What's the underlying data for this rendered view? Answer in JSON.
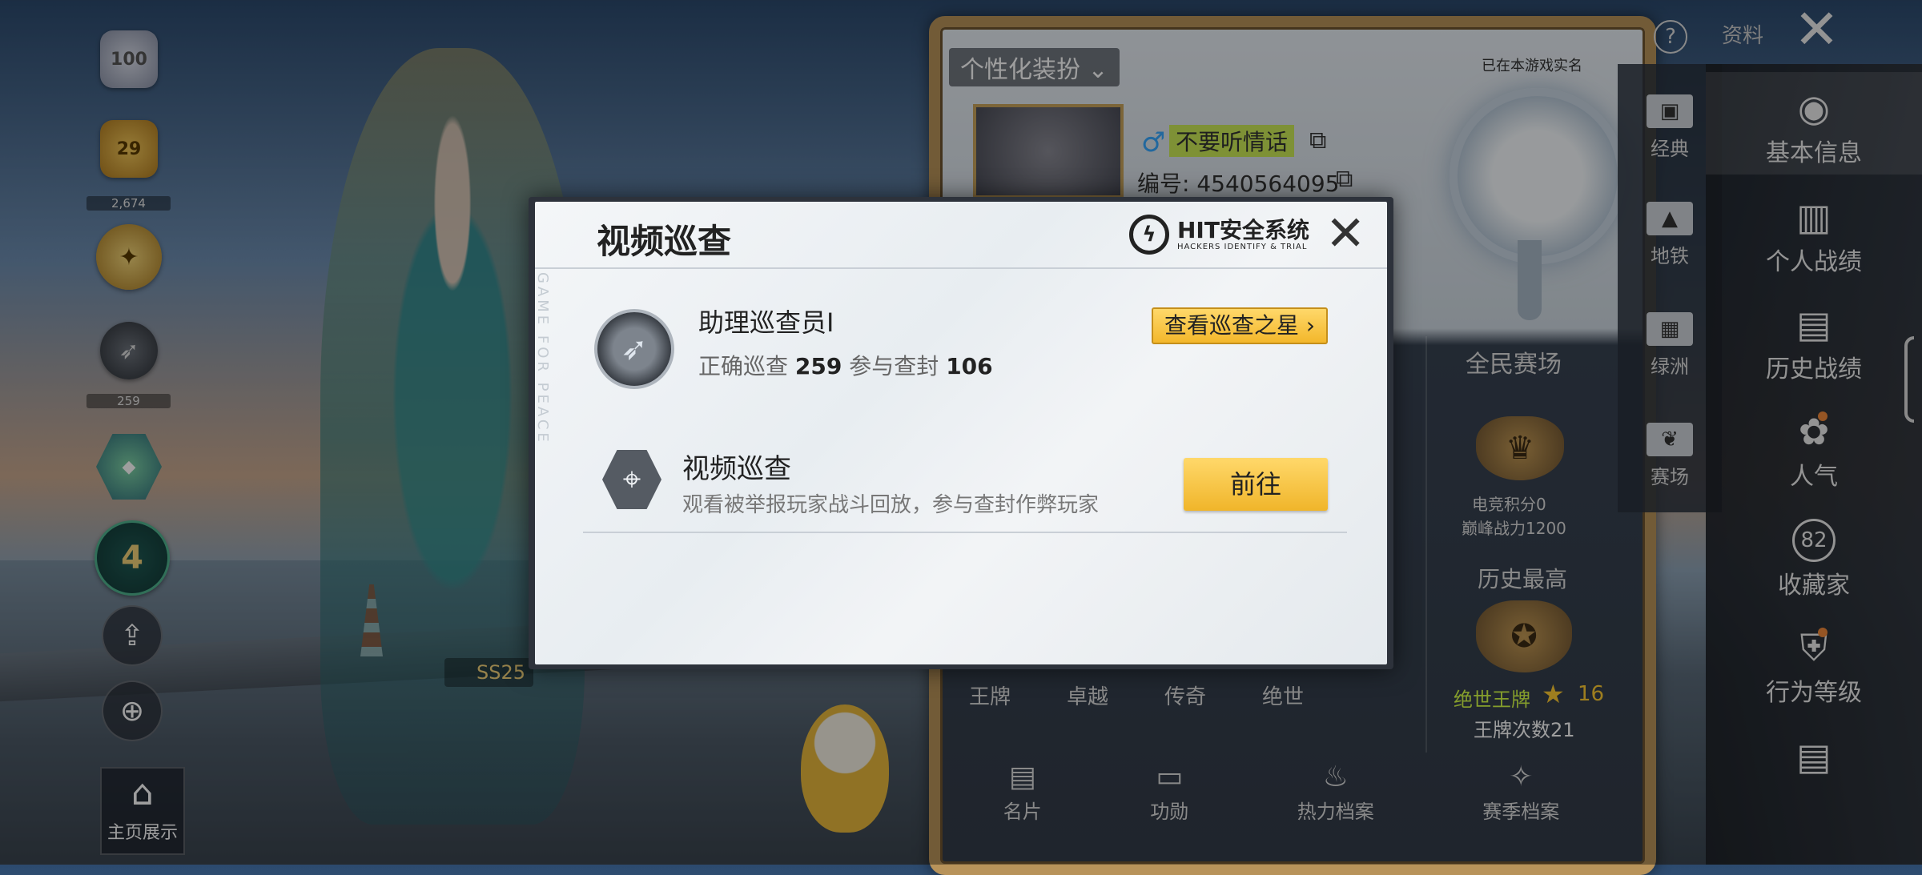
{
  "sidebar": {
    "badge1_value": "100",
    "badge2_value": "29",
    "badge2_count": "2,674",
    "badge4_count": "259",
    "badge6_value": "4",
    "home_show_label": "主页展示"
  },
  "profile": {
    "custom_label": "个性化装扮",
    "synced_text": "已在本游戏实名",
    "player_name": "不要听情话",
    "player_id": "编号: 4540564095",
    "gender_symbol": "♂",
    "help_icon": "?",
    "info_label": "资料",
    "mode_label": "全民赛场",
    "points_label": "电竞积分0",
    "peak_label": "巅峰战力1200",
    "history_label": "历史最高",
    "ace_tier": "绝世王牌",
    "ace_level": "16",
    "ace_count": "王牌次数21",
    "tiers": [
      "王牌",
      "卓越",
      "传奇",
      "绝世"
    ],
    "bottom_tabs": [
      "名片",
      "功勋",
      "热力档案",
      "赛季档案"
    ],
    "season_label": "SS25"
  },
  "categories": [
    "经典",
    "地铁",
    "绿洲",
    "赛场"
  ],
  "right_menu": [
    "基本信息",
    "个人战绩",
    "历史战绩",
    "人气",
    "收藏家",
    "行为等级"
  ],
  "collector_value": "82",
  "modal": {
    "title": "视频巡查",
    "logo_main": "HIT安全系统",
    "logo_sub": "HACKERS IDENTIFY & TRIAL",
    "watermark": "GAME FOR PEACE",
    "rank_name": "助理巡查员I",
    "correct_label": "正确巡查",
    "correct_value": "259",
    "ban_label": "参与查封",
    "ban_value": "106",
    "star_button": "查看巡查之星",
    "section_title": "视频巡查",
    "section_desc": "观看被举报玩家战斗回放，参与查封作弊玩家",
    "go_button": "前往"
  },
  "colors": {
    "accent_yellow": "#f3b72b",
    "name_highlight": "#c8eb3c",
    "ace_green": "#d7ff48"
  }
}
